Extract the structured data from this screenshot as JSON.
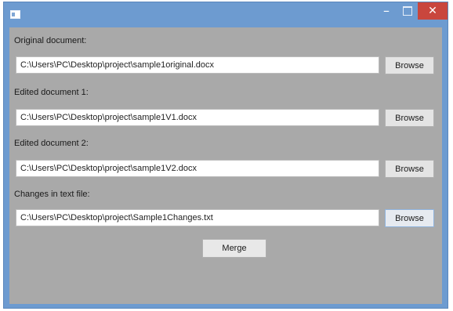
{
  "window": {
    "title": "",
    "controls": {
      "minimize": "–",
      "maximize": "",
      "close": "✕"
    }
  },
  "form": {
    "rows": [
      {
        "label": "Original document:",
        "path": "C:\\Users\\PC\\Desktop\\project\\sample1original.docx",
        "button": "Browse"
      },
      {
        "label": "Edited document 1:",
        "path": "C:\\Users\\PC\\Desktop\\project\\sample1V1.docx",
        "button": "Browse"
      },
      {
        "label": "Edited document 2:",
        "path": "C:\\Users\\PC\\Desktop\\project\\sample1V2.docx",
        "button": "Browse"
      },
      {
        "label": "Changes in text file:",
        "path": "C:\\Users\\PC\\Desktop\\project\\Sample1Changes.txt",
        "button": "Browse"
      }
    ],
    "merge_label": "Merge"
  },
  "colors": {
    "title_bar": "#6d9bd0",
    "client_bg": "#a9a9a9",
    "close_button": "#c9463d"
  }
}
